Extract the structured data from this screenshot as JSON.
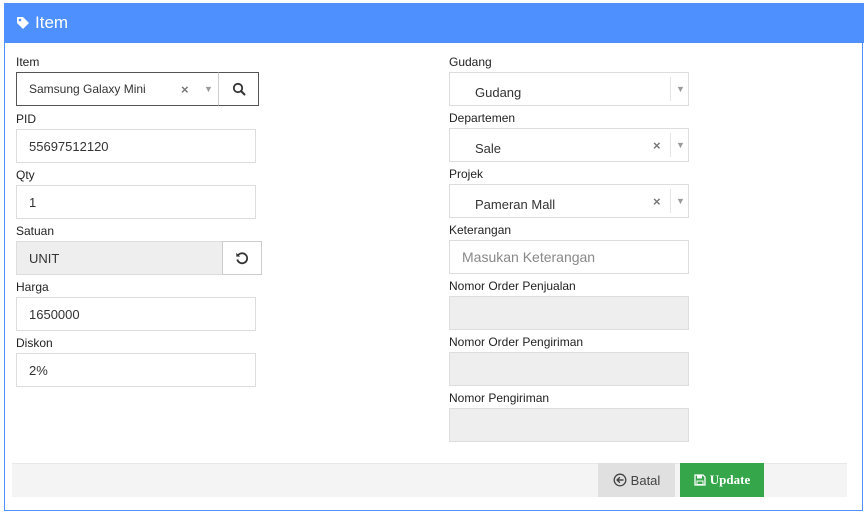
{
  "header": {
    "title": "Item"
  },
  "fields": {
    "item": {
      "label": "Item",
      "value": "Samsung Galaxy Mini"
    },
    "pid": {
      "label": "PID",
      "value": "55697512120"
    },
    "qty": {
      "label": "Qty",
      "value": "1"
    },
    "satuan": {
      "label": "Satuan",
      "value": "UNIT"
    },
    "harga": {
      "label": "Harga",
      "value": "1650000"
    },
    "diskon": {
      "label": "Diskon",
      "value": "2%"
    },
    "gudang": {
      "label": "Gudang",
      "value": "Gudang"
    },
    "departemen": {
      "label": "Departemen",
      "value": "Sale"
    },
    "projek": {
      "label": "Projek",
      "value": "Pameran Mall"
    },
    "keterangan": {
      "label": "Keterangan",
      "placeholder": "Masukan Keterangan"
    },
    "nomor_order_penjualan": {
      "label": "Nomor Order Penjualan",
      "value": ""
    },
    "nomor_order_pengiriman": {
      "label": "Nomor Order Pengiriman",
      "value": ""
    },
    "nomor_pengiriman": {
      "label": "Nomor Pengiriman",
      "value": ""
    }
  },
  "actions": {
    "cancel_label": "Batal",
    "update_label": "Update"
  },
  "glyphs": {
    "clear": "×",
    "arrow": "▼"
  },
  "colors": {
    "header": "#4d90fe",
    "update": "#35a64a",
    "cancel": "#e0e0e0",
    "readonly": "#eeeeee"
  }
}
